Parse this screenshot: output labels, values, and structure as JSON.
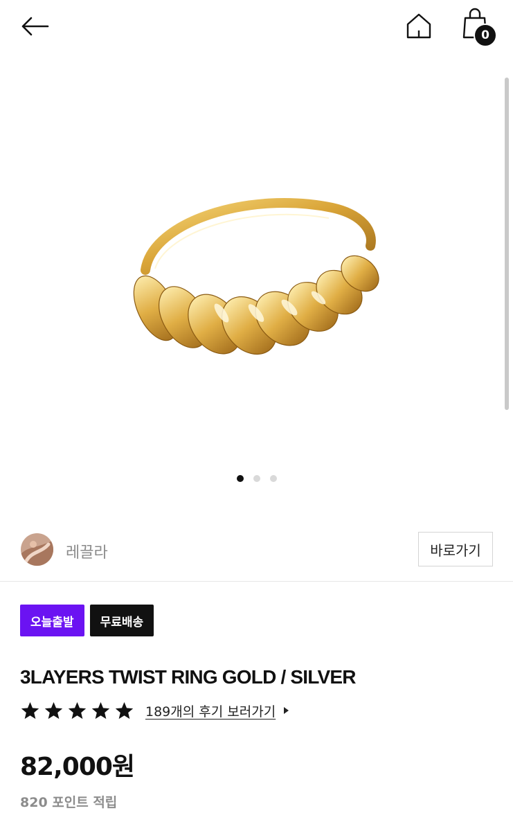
{
  "header": {
    "cart_count": "0",
    "icons": [
      "back-arrow-icon",
      "home-icon",
      "shopping-bag-icon"
    ]
  },
  "gallery": {
    "image_count": 3,
    "active_index": 0,
    "image_subject": "gold-twist-ring"
  },
  "seller": {
    "name": "레끌라",
    "goto_label": "바로가기"
  },
  "badges": [
    {
      "label": "오늘출발",
      "color": "#6b13f2"
    },
    {
      "label": "무료배송",
      "color": "#111111"
    }
  ],
  "product": {
    "title": "3LAYERS TWIST RING GOLD / SILVER",
    "rating_stars": 5,
    "reviews_link": "189개의 후기 보러가기",
    "price": "82,000원",
    "points": "820 포인트 적립"
  }
}
